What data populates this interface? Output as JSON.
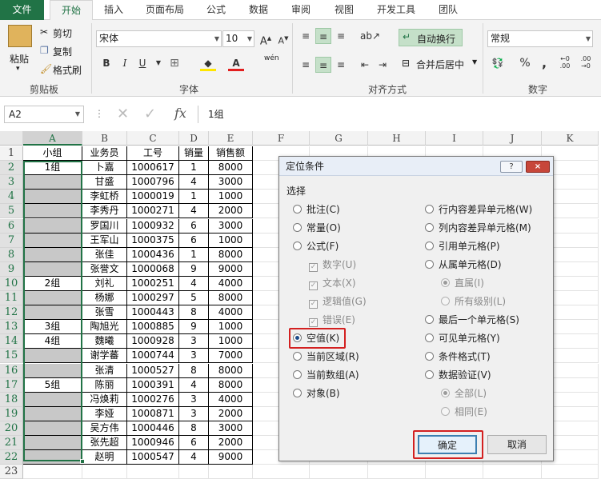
{
  "tabs": [
    "文件",
    "开始",
    "插入",
    "页面布局",
    "公式",
    "数据",
    "审阅",
    "视图",
    "开发工具",
    "团队"
  ],
  "ribbon": {
    "paste": "粘贴",
    "cut": "剪切",
    "copy": "复制",
    "format_painter": "格式刷",
    "clipboard": "剪贴板",
    "font_name": "宋体",
    "font_size": "10",
    "bold": "B",
    "italic": "I",
    "underline": "U",
    "font": "字体",
    "wen": "wén",
    "wrap": "自动换行",
    "merge": "合并后居中",
    "alignment": "对齐方式",
    "number_format": "常规",
    "percent": "%",
    "comma": ",",
    "number": "数字"
  },
  "namebox": "A2",
  "fx": "fx",
  "formula": "1组",
  "columns": [
    "A",
    "B",
    "C",
    "D",
    "E",
    "F",
    "G",
    "H",
    "I",
    "J",
    "K"
  ],
  "rows": [
    [
      "小组",
      "业务员",
      "工号",
      "销量",
      "销售额"
    ],
    [
      "1组",
      "卜嘉",
      "1000617",
      "1",
      "8000"
    ],
    [
      "",
      "甘盛",
      "1000796",
      "4",
      "3000"
    ],
    [
      "",
      "李虹桥",
      "1000019",
      "1",
      "1000"
    ],
    [
      "",
      "李秀丹",
      "1000271",
      "4",
      "2000"
    ],
    [
      "",
      "罗国川",
      "1000932",
      "6",
      "3000"
    ],
    [
      "",
      "王军山",
      "1000375",
      "6",
      "1000"
    ],
    [
      "",
      "张佳",
      "1000436",
      "1",
      "8000"
    ],
    [
      "",
      "张誉文",
      "1000068",
      "9",
      "9000"
    ],
    [
      "2组",
      "刘礼",
      "1000251",
      "4",
      "4000"
    ],
    [
      "",
      "杨娜",
      "1000297",
      "5",
      "8000"
    ],
    [
      "",
      "张雪",
      "1000443",
      "8",
      "4000"
    ],
    [
      "3组",
      "陶旭光",
      "1000885",
      "9",
      "1000"
    ],
    [
      "4组",
      "魏曦",
      "1000928",
      "3",
      "1000"
    ],
    [
      "",
      "谢学蕃",
      "1000744",
      "3",
      "7000"
    ],
    [
      "",
      "张清",
      "1000527",
      "8",
      "8000"
    ],
    [
      "5组",
      "陈丽",
      "1000391",
      "4",
      "8000"
    ],
    [
      "",
      "冯焕莉",
      "1000276",
      "3",
      "4000"
    ],
    [
      "",
      "李娅",
      "1000871",
      "3",
      "2000"
    ],
    [
      "",
      "吴方伟",
      "1000446",
      "8",
      "3000"
    ],
    [
      "",
      "张先超",
      "1000946",
      "6",
      "2000"
    ],
    [
      "",
      "赵明",
      "1000547",
      "4",
      "9000"
    ],
    [
      "",
      "",
      "",
      "",
      ""
    ]
  ],
  "dialog": {
    "title": "定位条件",
    "help": "?",
    "close": "×",
    "section": "选择",
    "left": [
      "批注(C)",
      "常量(O)",
      "公式(F)",
      "数字(U)",
      "文本(X)",
      "逻辑值(G)",
      "错误(E)",
      "空值(K)",
      "当前区域(R)",
      "当前数组(A)",
      "对象(B)"
    ],
    "right": [
      "行内容差异单元格(W)",
      "列内容差异单元格(M)",
      "引用单元格(P)",
      "从属单元格(D)",
      "直属(I)",
      "所有级别(L)",
      "最后一个单元格(S)",
      "可见单元格(Y)",
      "条件格式(T)",
      "数据验证(V)",
      "全部(L)",
      "相同(E)"
    ],
    "ok": "确定",
    "cancel": "取消"
  }
}
